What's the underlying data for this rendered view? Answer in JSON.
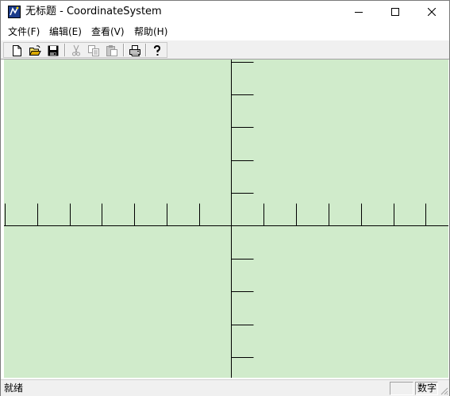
{
  "window": {
    "title": "无标题 - CoordinateSystem",
    "app_icon": "mfc-app-icon",
    "controls": {
      "minimize_icon": "minimize-icon",
      "maximize_icon": "maximize-icon",
      "close_icon": "close-icon"
    }
  },
  "menu": {
    "items": [
      {
        "label": "文件(F)"
      },
      {
        "label": "编辑(E)"
      },
      {
        "label": "查看(V)"
      },
      {
        "label": "帮助(H)"
      }
    ]
  },
  "toolbar": {
    "buttons": [
      {
        "icon": "new-document-icon",
        "enabled": true
      },
      {
        "icon": "open-folder-icon",
        "enabled": true
      },
      {
        "icon": "save-disk-icon",
        "enabled": true
      },
      {
        "icon": "cut-scissors-icon",
        "enabled": false
      },
      {
        "icon": "copy-icon",
        "enabled": false
      },
      {
        "icon": "paste-icon",
        "enabled": false
      },
      {
        "icon": "print-icon",
        "enabled": true
      },
      {
        "icon": "help-icon",
        "enabled": true
      }
    ]
  },
  "canvas": {
    "background_color": "#d0ebcb",
    "axis_color": "#000000",
    "tick_count_x_left": 7,
    "tick_count_x_right": 6,
    "tick_count_y_up": 5,
    "tick_count_y_down": 4
  },
  "statusbar": {
    "text": "就绪",
    "indicator_label": "数字"
  }
}
